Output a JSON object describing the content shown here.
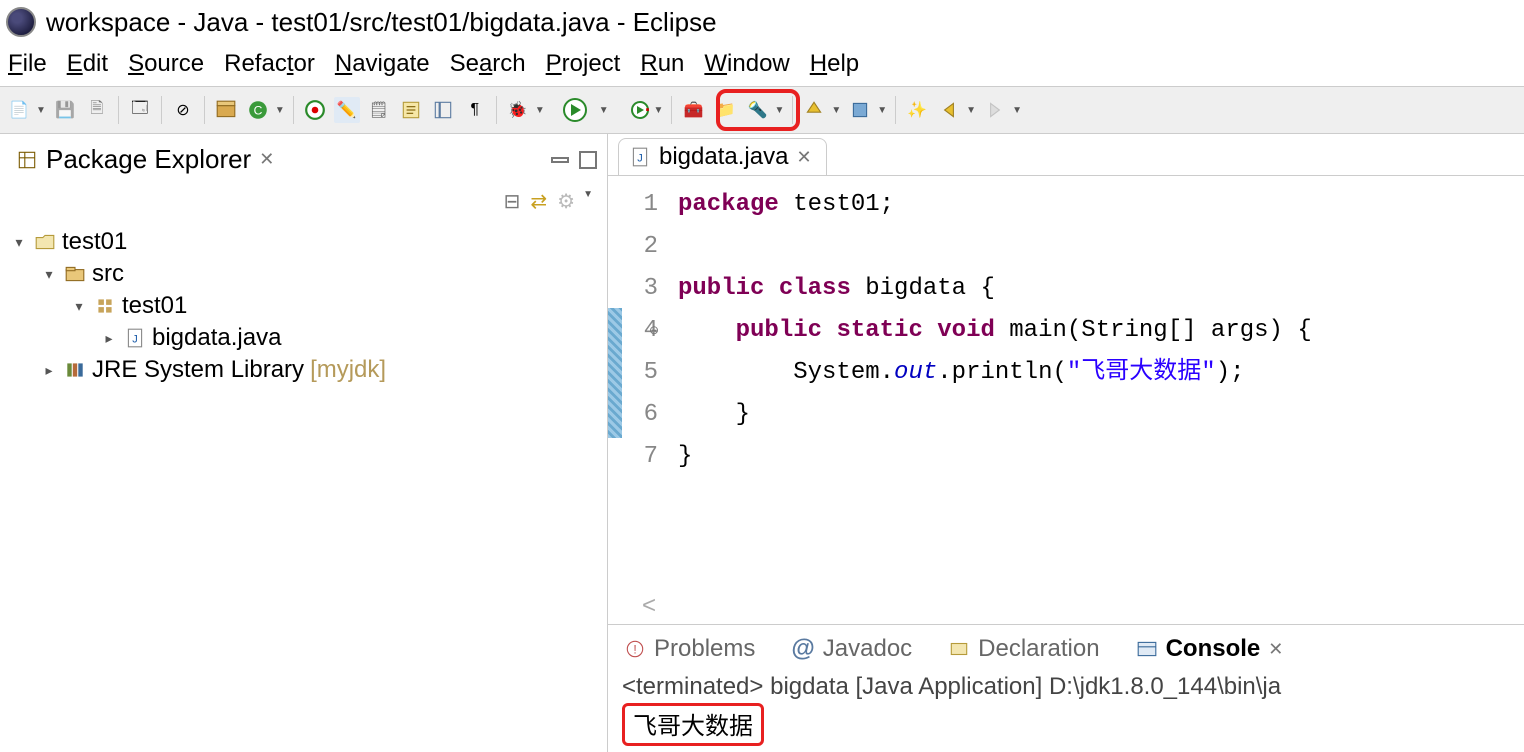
{
  "title": "workspace - Java - test01/src/test01/bigdata.java - Eclipse",
  "menu": [
    "File",
    "Edit",
    "Source",
    "Refactor",
    "Navigate",
    "Search",
    "Project",
    "Run",
    "Window",
    "Help"
  ],
  "package_explorer": {
    "title": "Package Explorer",
    "project": "test01",
    "src": "src",
    "pkg": "test01",
    "file": "bigdata.java",
    "jre_label": "JRE System Library",
    "jre_suffix": "[myjdk]"
  },
  "editor": {
    "tab": "bigdata.java",
    "lines": [
      "1",
      "2",
      "3",
      "4",
      "5",
      "6",
      "7"
    ],
    "code": {
      "l1_package": "package",
      "l1_rest": " test01;",
      "l3_public": "public",
      "l3_class": "class",
      "l3_rest": " bigdata {",
      "l4_public": "public",
      "l4_static": "static",
      "l4_void": "void",
      "l4_rest": " main(String[] args) {",
      "l5_system": "System.",
      "l5_out": "out",
      "l5_println": ".println(",
      "l5_string": "\"飞哥大数据\"",
      "l5_end": ");",
      "l6": "    }",
      "l7": "}"
    }
  },
  "bottom": {
    "tabs": [
      "Problems",
      "Javadoc",
      "Declaration",
      "Console"
    ],
    "console_status": "<terminated> bigdata [Java Application] D:\\jdk1.8.0_144\\bin\\ja",
    "console_output": "飞哥大数据"
  }
}
